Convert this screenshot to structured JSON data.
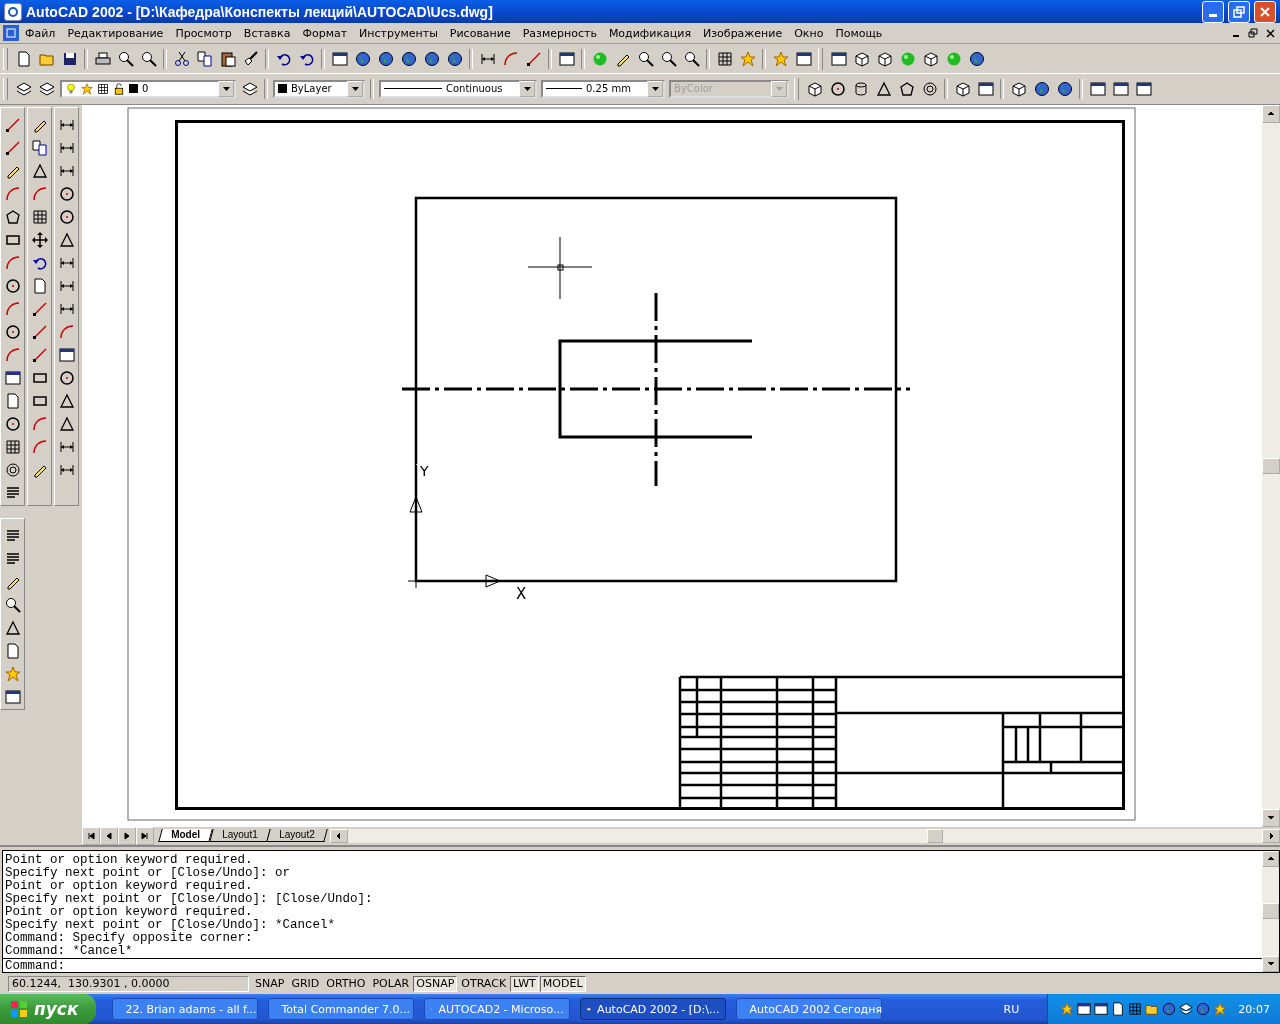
{
  "window": {
    "title": "AutoCAD 2002 - [D:\\Кафедра\\Конспекты лекций\\AUTOCAD\\Ucs.dwg]"
  },
  "menu": [
    "Файл",
    "Редактирование",
    "Просмотр",
    "Вставка",
    "Формат",
    "Инструменты",
    "Рисование",
    "Размерность",
    "Модификация",
    "Изображение",
    "Окно",
    "Помощь"
  ],
  "properties_bar": {
    "layer": "0",
    "color_control": "ByLayer",
    "linetype": "Continuous",
    "lineweight": "0.25 mm",
    "plot_style": {
      "value": "ByColor",
      "disabled": true
    }
  },
  "drawing": {
    "ucs_icon": {
      "x_label": "X",
      "y_label": "Y"
    }
  },
  "layout_tabs": [
    {
      "label": "Model",
      "selected": true
    },
    {
      "label": "Layout1",
      "selected": false
    },
    {
      "label": "Layout2",
      "selected": false
    }
  ],
  "command_history": [
    "Point or option keyword required.",
    "Specify next point or [Close/Undo]: or",
    "Point or option keyword required.",
    "Specify next point or [Close/Undo]: [Close/Undo]:",
    "Point or option keyword required.",
    "Specify next point or [Close/Undo]: *Cancel*",
    "Command: Specify opposite corner:",
    "Command: *Cancel*"
  ],
  "command_prompt": "Command:",
  "status_bar": {
    "coordinates": "60.1244,  130.9301 , 0.0000",
    "toggles": [
      {
        "label": "SNAP",
        "on": false
      },
      {
        "label": "GRID",
        "on": false
      },
      {
        "label": "ORTHO",
        "on": false
      },
      {
        "label": "POLAR",
        "on": false
      },
      {
        "label": "OSNAP",
        "on": true
      },
      {
        "label": "OTRACK",
        "on": false
      },
      {
        "label": "LWT",
        "on": true
      },
      {
        "label": "MODEL",
        "on": true
      }
    ]
  },
  "taskbar": {
    "start": "пуск",
    "tasks": [
      {
        "label": "22. Brian adams - all f...",
        "selected": false
      },
      {
        "label": "Total Commander 7.0...",
        "selected": false
      },
      {
        "label": "AUTOCAD2 - Microso...",
        "selected": false
      },
      {
        "label": "AutoCAD 2002 - [D:\\...",
        "selected": true
      },
      {
        "label": "AutoCAD 2002 Сегодня",
        "selected": false
      }
    ],
    "language": "RU",
    "clock": "20:07"
  }
}
